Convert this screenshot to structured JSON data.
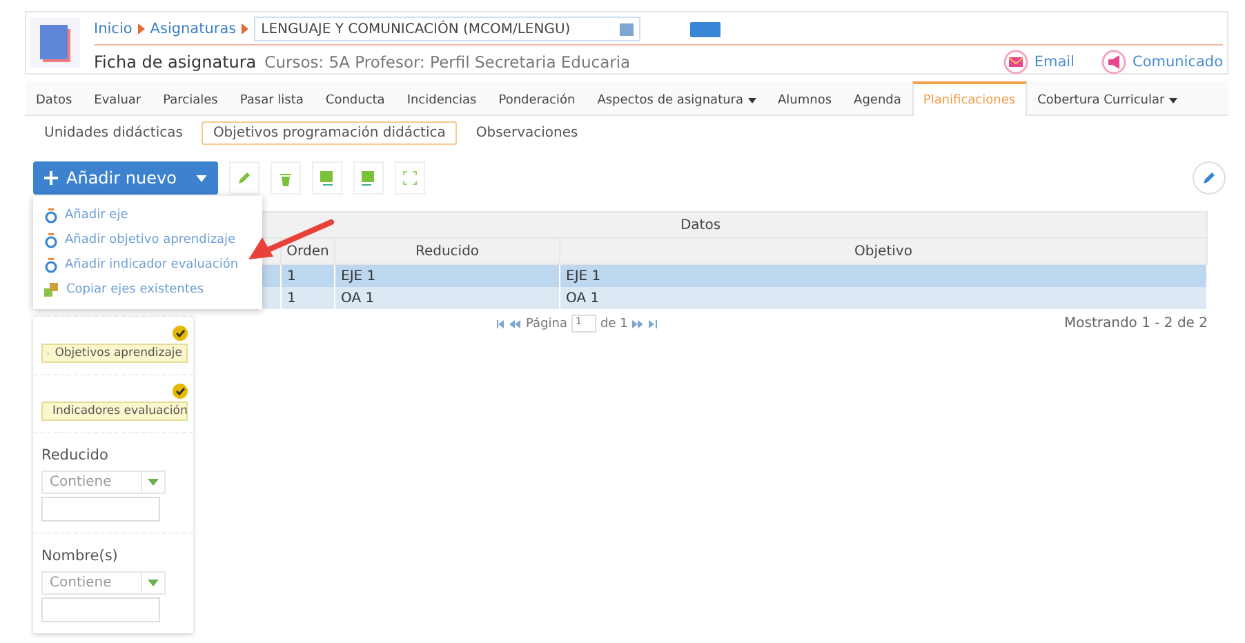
{
  "breadcrumb": [
    {
      "label": "Inicio"
    },
    {
      "label": "Asignaturas"
    }
  ],
  "subject_select": {
    "value": "LENGUAJE Y COMUNICACIÓN (MCOM/LENGU)"
  },
  "header": {
    "title": "Ficha de asignatura",
    "subtitle": "Cursos: 5A Profesor: Perfil Secretaria Educaria"
  },
  "actions": [
    {
      "kind": "email",
      "label": "Email"
    },
    {
      "kind": "notice",
      "label": "Comunicado"
    }
  ],
  "tabs": [
    {
      "label": "Datos",
      "selected": false,
      "menu": false
    },
    {
      "label": "Evaluar",
      "selected": false,
      "menu": false
    },
    {
      "label": "Parciales",
      "selected": false,
      "menu": false
    },
    {
      "label": "Pasar lista",
      "selected": false,
      "menu": false
    },
    {
      "label": "Conducta",
      "selected": false,
      "menu": false
    },
    {
      "label": "Incidencias",
      "selected": false,
      "menu": false
    },
    {
      "label": "Ponderación",
      "selected": false,
      "menu": false
    },
    {
      "label": "Aspectos de asignatura",
      "selected": false,
      "menu": true
    },
    {
      "label": "Alumnos",
      "selected": false,
      "menu": false
    },
    {
      "label": "Agenda",
      "selected": false,
      "menu": false
    },
    {
      "label": "Planificaciones",
      "selected": true,
      "menu": false
    },
    {
      "label": "Cobertura Curricular",
      "selected": false,
      "menu": true
    }
  ],
  "subtabs": [
    {
      "label": "Unidades didácticas",
      "selected": false
    },
    {
      "label": "Objetivos programación didáctica",
      "selected": true
    },
    {
      "label": "Observaciones",
      "selected": false
    }
  ],
  "add_button": {
    "label": "Añadir nuevo"
  },
  "add_menu": [
    {
      "kind": "timer",
      "label": "Añadir eje"
    },
    {
      "kind": "timer",
      "label": "Añadir objetivo aprendizaje"
    },
    {
      "kind": "timer",
      "label": "Añadir indicador evaluación"
    },
    {
      "kind": "copy",
      "label": "Copiar ejes existentes"
    }
  ],
  "toolbar": [
    {
      "kind": "edit"
    },
    {
      "kind": "delete"
    },
    {
      "kind": "export"
    },
    {
      "kind": "import"
    },
    {
      "kind": "expand"
    }
  ],
  "filters": [
    {
      "kind": "check",
      "label": "Objetivos aprendizaje",
      "checked": true
    },
    {
      "kind": "check",
      "label": "Indicadores evaluación",
      "checked": true
    },
    {
      "kind": "text",
      "label": "Reducido",
      "operator": "Contiene"
    },
    {
      "kind": "text",
      "label": "Nombre(s)",
      "operator": "Contiene"
    }
  ],
  "table": {
    "group_header": "Datos",
    "columns": [
      "Orden",
      "Reducido",
      "Objetivo"
    ],
    "rows": [
      {
        "selected": true,
        "cells": [
          "1",
          "EJE 1",
          "EJE 1"
        ]
      },
      {
        "selected": false,
        "cells": [
          "1",
          "OA 1",
          "OA 1"
        ]
      }
    ]
  },
  "pager": {
    "page_label": "Página",
    "page": "1",
    "of_label": "de",
    "total": "1"
  },
  "summary": "Mostrando 1 - 2 de 2"
}
